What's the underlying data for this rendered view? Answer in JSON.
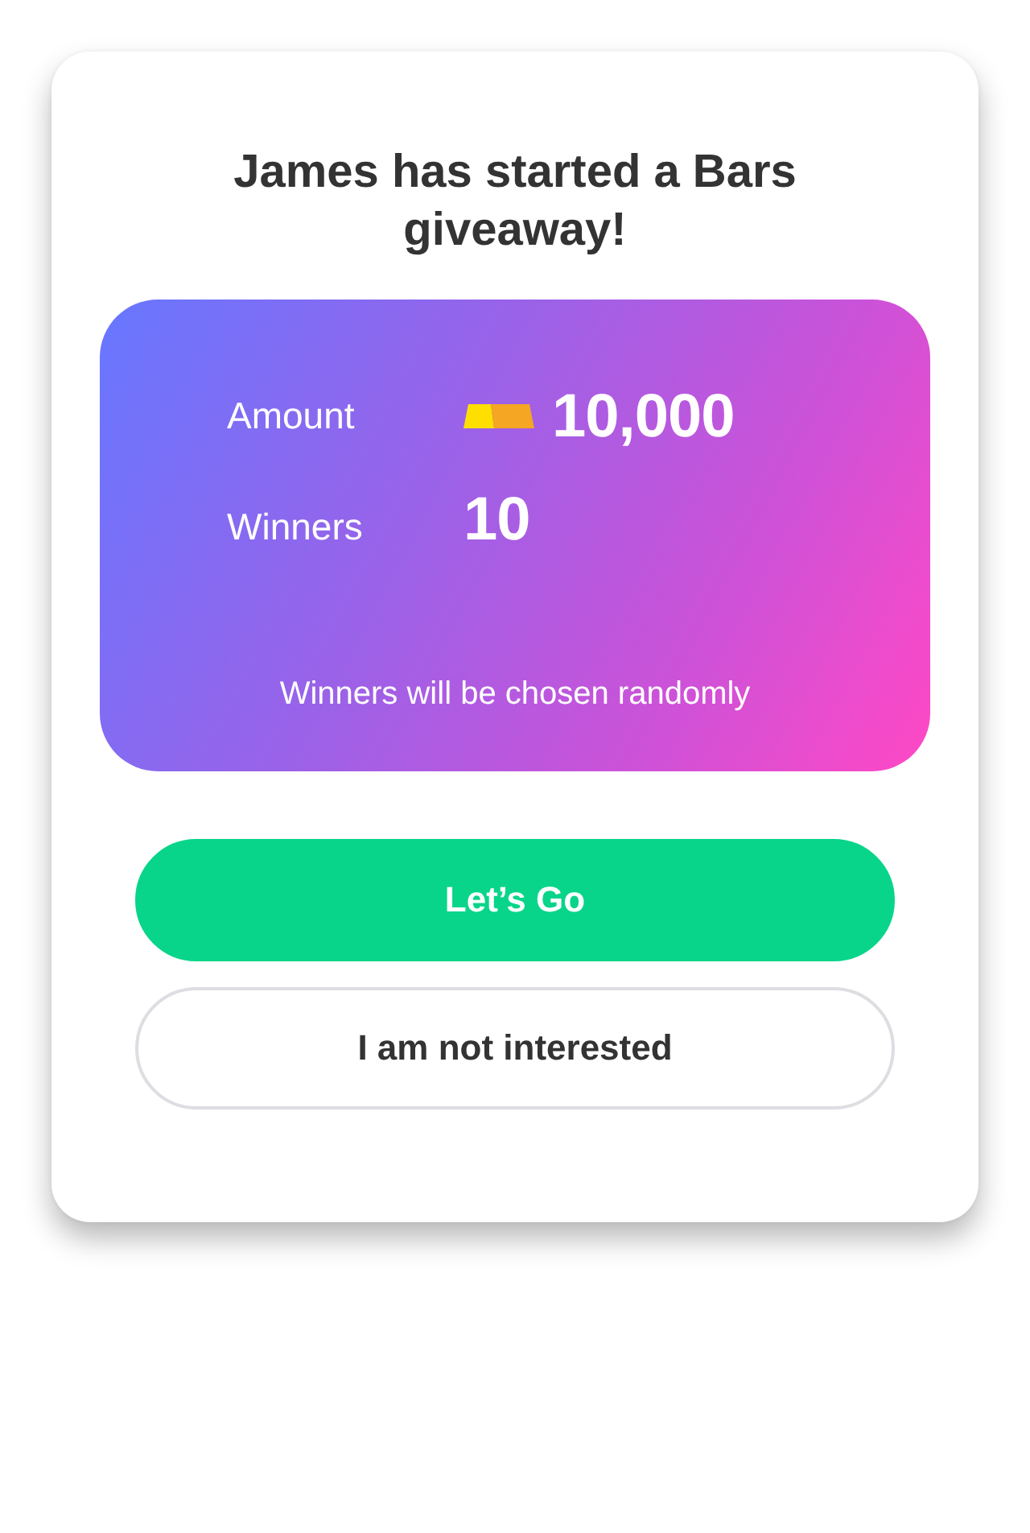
{
  "dialog": {
    "title": "James has started a Bars giveaway!",
    "giveaway": {
      "rows": [
        {
          "label": "Amount",
          "value": "10,000",
          "kind": "bars"
        },
        {
          "label": "Winners",
          "value": "10",
          "kind": "count"
        }
      ],
      "note": "Winners will be chosen randomly"
    },
    "buttons": [
      {
        "label": "Let’s Go",
        "kind": "primary"
      },
      {
        "label": "I am not interested",
        "kind": "secondary"
      }
    ]
  }
}
